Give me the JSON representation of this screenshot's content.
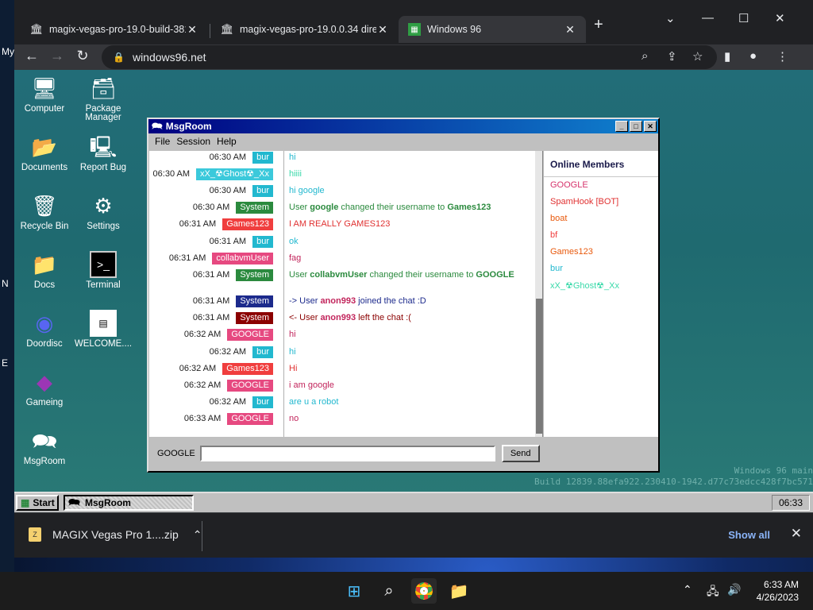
{
  "browser": {
    "tabs": [
      {
        "title": "magix-vegas-pro-19.0-build-381",
        "favicon": "museum-icon"
      },
      {
        "title": "magix-vegas-pro-19.0.0.34 direc",
        "favicon": "museum-icon"
      },
      {
        "title": "Windows 96",
        "favicon": "windows96-icon"
      }
    ],
    "address": "windows96.net"
  },
  "left_edge": [
    "My",
    "N",
    "E"
  ],
  "desktop": {
    "icons": [
      {
        "label": "Computer",
        "icon": "computer-icon"
      },
      {
        "label": "Package Manager",
        "icon": "package-icon"
      },
      {
        "label": "Documents",
        "icon": "folder-docs-icon"
      },
      {
        "label": "Report Bug",
        "icon": "bug-report-icon"
      },
      {
        "label": "Recycle Bin",
        "icon": "recycle-bin-icon"
      },
      {
        "label": "Settings",
        "icon": "settings-icon"
      },
      {
        "label": "Docs",
        "icon": "folder-icon"
      },
      {
        "label": "Terminal",
        "icon": "terminal-icon"
      },
      {
        "label": "Doordisc",
        "icon": "discord-icon"
      },
      {
        "label": "WELCOME....",
        "icon": "text-file-icon"
      },
      {
        "label": "Gameing",
        "icon": "cube-icon"
      },
      {
        "label": "MsgRoom",
        "icon": "chat-icon"
      }
    ],
    "watermark_line1": "Windows 96 main",
    "watermark_line2": "Build 12839.88efa922.230410-1942.d77c73edcc428f7bc571"
  },
  "msgroom": {
    "title": "MsgRoom",
    "menu": [
      "File",
      "Session",
      "Help"
    ],
    "members_title": "Online Members",
    "members": [
      {
        "name": "GOOGLE",
        "color": "#d6336c"
      },
      {
        "name": "SpamHook [BOT]",
        "color": "#e03131"
      },
      {
        "name": "boat",
        "color": "#e8590c"
      },
      {
        "name": "bf",
        "color": "#f03e3e"
      },
      {
        "name": "Games123",
        "color": "#e8590c"
      },
      {
        "name": "bur",
        "color": "#22b8cf"
      },
      {
        "name": "xX_☢Ghost☢_Xx",
        "color": "#38d9a9"
      }
    ],
    "messages": [
      {
        "time": "06:30 AM",
        "user": "bur",
        "user_bg": "#22b8cf",
        "text": "hi",
        "text_color": "#22b8cf"
      },
      {
        "time": "06:30 AM",
        "user": "xX_☢Ghost☢_Xx",
        "user_bg": "#3bc9db",
        "text": "hiiii",
        "text_color": "#38d9a9"
      },
      {
        "time": "06:30 AM",
        "user": "bur",
        "user_bg": "#22b8cf",
        "text": "hi google",
        "text_color": "#22b8cf"
      },
      {
        "time": "06:30 AM",
        "user": "System",
        "user_bg": "#2b8a3e",
        "text": "User google changed their username to Games123",
        "text_color": "#2b8a3e"
      },
      {
        "time": "06:31 AM",
        "user": "Games123",
        "user_bg": "#f03e3e",
        "text": "I AM REALLY GAMES123",
        "text_color": "#e03131"
      },
      {
        "time": "06:31 AM",
        "user": "bur",
        "user_bg": "#22b8cf",
        "text": "ok",
        "text_color": "#22b8cf"
      },
      {
        "time": "06:31 AM",
        "user": "collabvmUser",
        "user_bg": "#e64980",
        "text": "fag",
        "text_color": "#c2255c"
      },
      {
        "time": "06:31 AM",
        "user": "System",
        "user_bg": "#2b8a3e",
        "text": "User collabvmUser changed their username to GOOGLE",
        "text_color": "#2b8a3e"
      },
      {
        "time": "06:31 AM",
        "user": "System",
        "user_bg": "#1c2a8c",
        "text": "-> User anon993 joined the chat :D",
        "text_color": "#1c2a8c"
      },
      {
        "time": "06:31 AM",
        "user": "System",
        "user_bg": "#8b0000",
        "text": "<- User anon993 left the chat :(",
        "text_color": "#8b0000"
      },
      {
        "time": "06:32 AM",
        "user": "GOOGLE",
        "user_bg": "#e64980",
        "text": "hi",
        "text_color": "#c2255c"
      },
      {
        "time": "06:32 AM",
        "user": "bur",
        "user_bg": "#22b8cf",
        "text": "hi",
        "text_color": "#22b8cf"
      },
      {
        "time": "06:32 AM",
        "user": "Games123",
        "user_bg": "#f03e3e",
        "text": "Hi",
        "text_color": "#e03131"
      },
      {
        "time": "06:32 AM",
        "user": "GOOGLE",
        "user_bg": "#e64980",
        "text": "i am google",
        "text_color": "#c2255c"
      },
      {
        "time": "06:32 AM",
        "user": "bur",
        "user_bg": "#22b8cf",
        "text": "are u a robot",
        "text_color": "#22b8cf"
      },
      {
        "time": "06:33 AM",
        "user": "GOOGLE",
        "user_bg": "#e64980",
        "text": "no",
        "text_color": "#c2255c"
      }
    ],
    "input_username": "GOOGLE",
    "input_value": "",
    "send_label": "Send"
  },
  "w96_taskbar": {
    "start_label": "Start",
    "task_label": "MsgRoom",
    "clock": "06:33"
  },
  "download_shelf": {
    "file": "MAGIX Vegas Pro 1....zip",
    "show_all": "Show all"
  },
  "win11": {
    "time": "6:33 AM",
    "date": "4/26/2023"
  }
}
